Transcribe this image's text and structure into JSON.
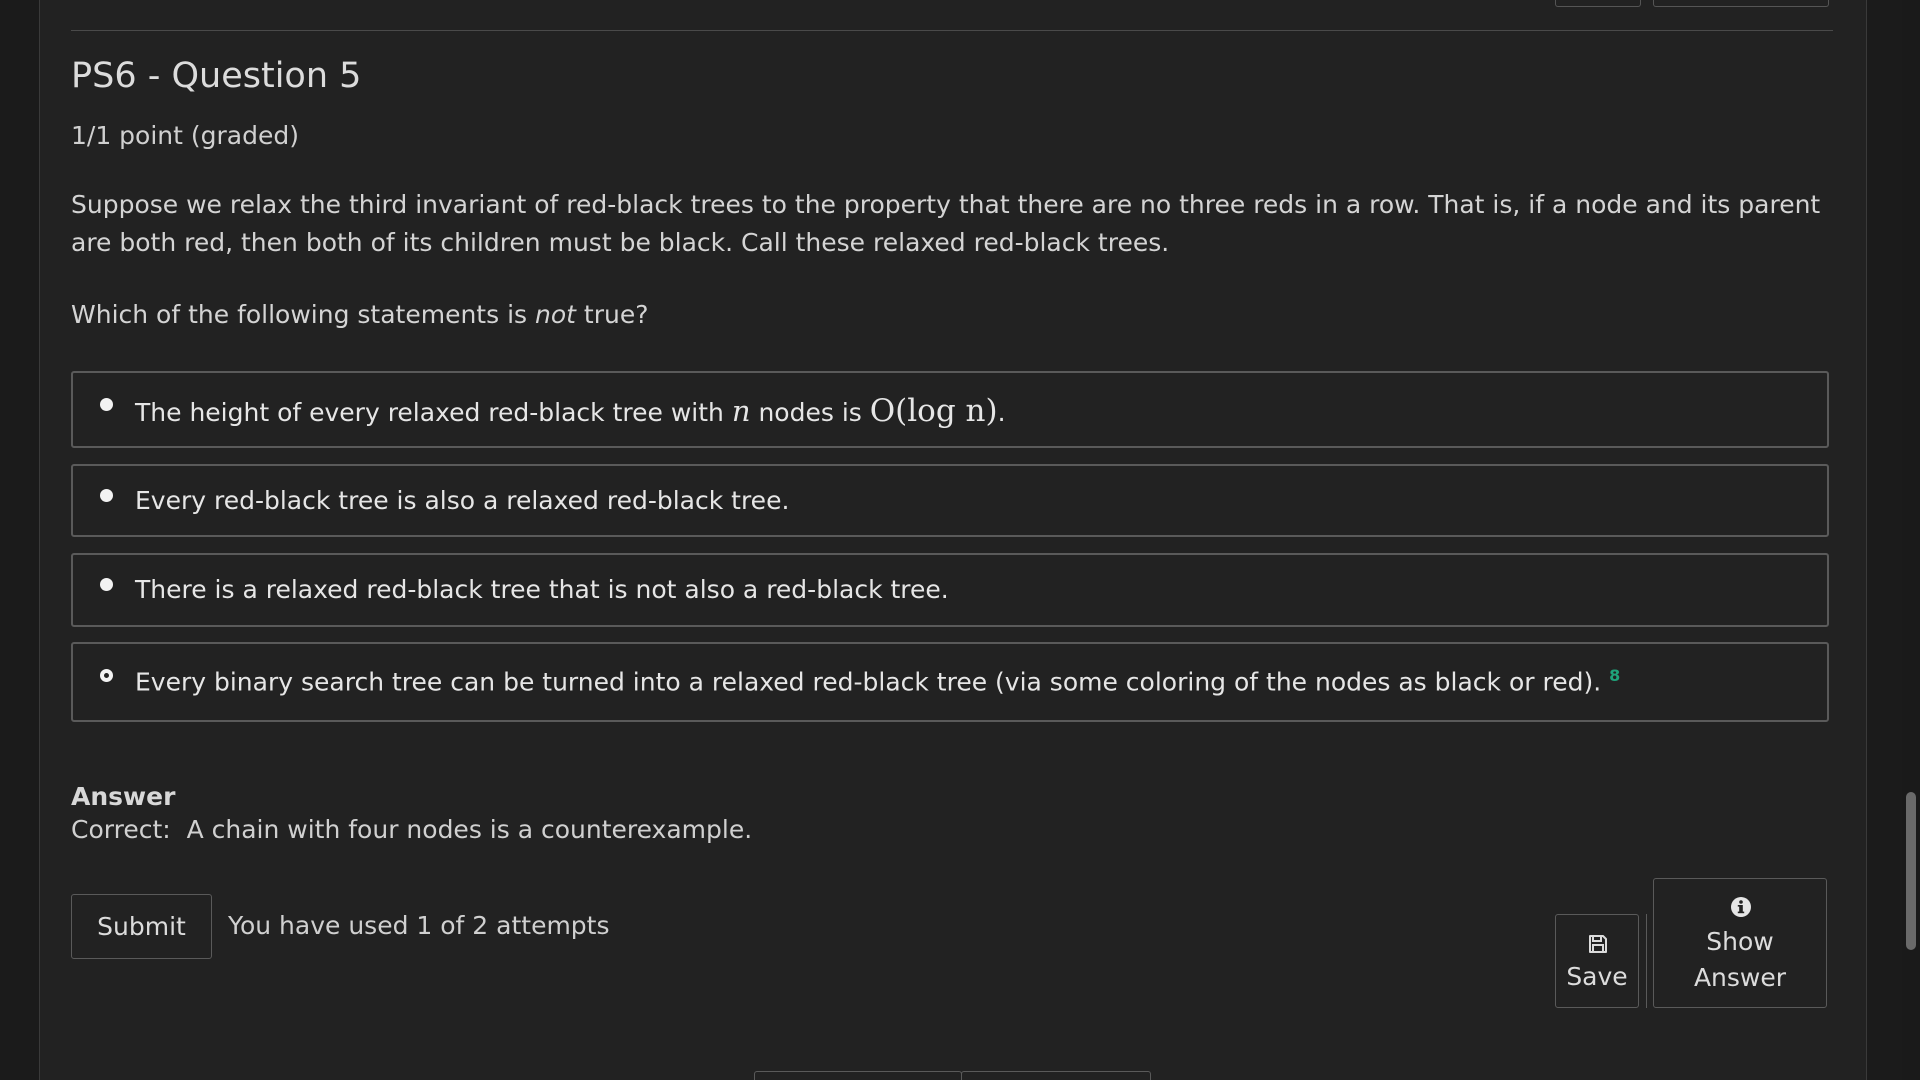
{
  "problem": {
    "title": "PS6 - Question 5",
    "score": "1/1 point (graded)",
    "prompt": "Suppose we relax the third invariant of red-black trees to the property that there are no three reds in a row. That is, if a node and its parent are both red, then both of its children must be black. Call these relaxed red-black trees.",
    "question_before": "Which of the following statements is ",
    "question_emphasis": "not",
    "question_after": " true?"
  },
  "options": [
    {
      "text_before": "The height of every relaxed red-black tree with ",
      "math_var": "n",
      "text_mid": " nodes is ",
      "math_bigo": "O(log n)",
      "text_after": ".",
      "selected": false
    },
    {
      "text": "Every red-black tree is also a relaxed red-black tree.",
      "selected": false
    },
    {
      "text": "There is a relaxed red-black tree that is not also a red-black tree.",
      "selected": false
    },
    {
      "text": "Every binary search tree can be turned into a relaxed red-black tree (via some coloring of the nodes as black or red).",
      "selected": true,
      "status_mark": "8"
    }
  ],
  "answer": {
    "heading": "Answer",
    "label": "Correct:",
    "text": "A chain with four nodes is a counterexample."
  },
  "actions": {
    "submit_label": "Submit",
    "attempts_text": "You have used 1 of 2 attempts",
    "save_label": "Save",
    "show_answer_line1": "Show",
    "show_answer_line2": "Answer"
  },
  "icons": {
    "save": "floppy-disk-icon",
    "show_answer": "info-circle-icon"
  },
  "colors": {
    "background": "#222222",
    "text": "#d8d8d8",
    "correct_mark": "#1fa37a"
  }
}
